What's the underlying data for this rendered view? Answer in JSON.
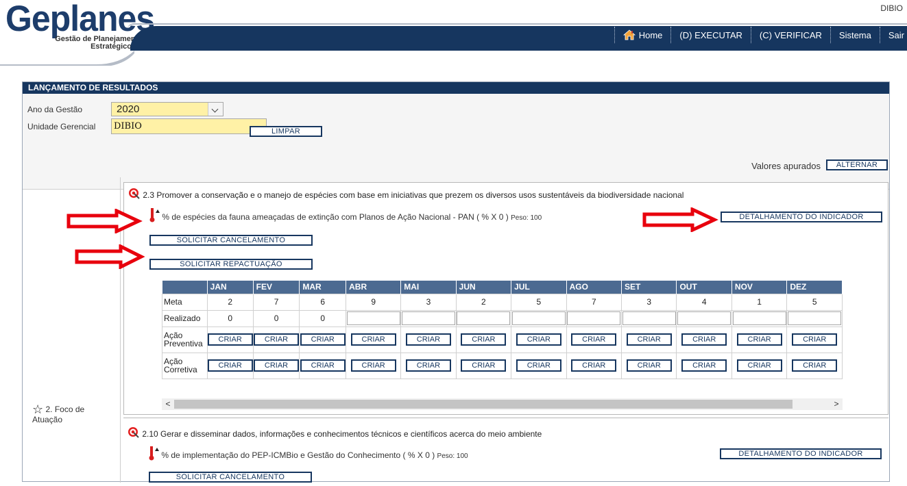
{
  "header": {
    "logo": "Geplanes",
    "logo_sub1": "Gestão de Planejamento",
    "logo_sub2": "Estratégico",
    "user": "DIBIO",
    "nav": [
      "Home",
      "(D) EXECUTAR",
      "(C) VERIFICAR",
      "Sistema",
      "Sair"
    ]
  },
  "panel": {
    "title": "LANÇAMENTO DE RESULTADOS",
    "ano_label": "Ano da Gestão",
    "ano_value": "2020",
    "unidade_label": "Unidade Gerencial",
    "unidade_value": "DIBIO",
    "limpar": "LIMPAR",
    "valores_label": "Valores apurados",
    "alternar": "ALTERNAR"
  },
  "foco": {
    "label_1": "2. Foco de",
    "label_2": "Atuação"
  },
  "objetivo1": {
    "title": "2.3 Promover a conservação e o manejo de espécies com base em iniciativas que prezem os diversos usos sustentáveis da biodiversidade nacional",
    "indicador": "% de espécies da fauna ameaçadas de extinção com Planos de Ação Nacional - PAN ( % X 0 )",
    "peso": "Peso: 100",
    "detalhamento": "DETALHAMENTO DO INDICADOR",
    "solicitar_cancelamento": "SOLICITAR CANCELAMENTO",
    "solicitar_repactuacao": "SOLICITAR REPACTUAÇÃO",
    "months": [
      "JAN",
      "FEV",
      "MAR",
      "ABR",
      "MAI",
      "JUN",
      "JUL",
      "AGO",
      "SET",
      "OUT",
      "NOV",
      "DEZ"
    ],
    "meta_label": "Meta",
    "meta": [
      "2",
      "7",
      "6",
      "9",
      "3",
      "2",
      "5",
      "7",
      "3",
      "4",
      "1",
      "5"
    ],
    "realizado_label": "Realizado",
    "realizado": [
      "0",
      "0",
      "0"
    ],
    "acao_preventiva_1": "Ação",
    "acao_preventiva_2": "Preventiva",
    "acao_corretiva_1": "Ação",
    "acao_corretiva_2": "Corretiva",
    "criar": "CRIAR"
  },
  "objetivo2": {
    "title": "2.10 Gerar e disseminar dados, informações e conhecimentos técnicos e científicos acerca do meio ambiente",
    "indicador": "% de implementação do PEP-ICMBio e Gestão do Conhecimento ( % X 0 )",
    "peso": "Peso: 100",
    "detalhamento": "DETALHAMENTO DO INDICADOR",
    "solicitar_cancelamento": "SOLICITAR CANCELAMENTO"
  },
  "colors": {
    "navy": "#16365f",
    "grid_header": "#4c6a91",
    "input_yellow": "#fff1a6",
    "arrow_red": "#e8000d"
  }
}
